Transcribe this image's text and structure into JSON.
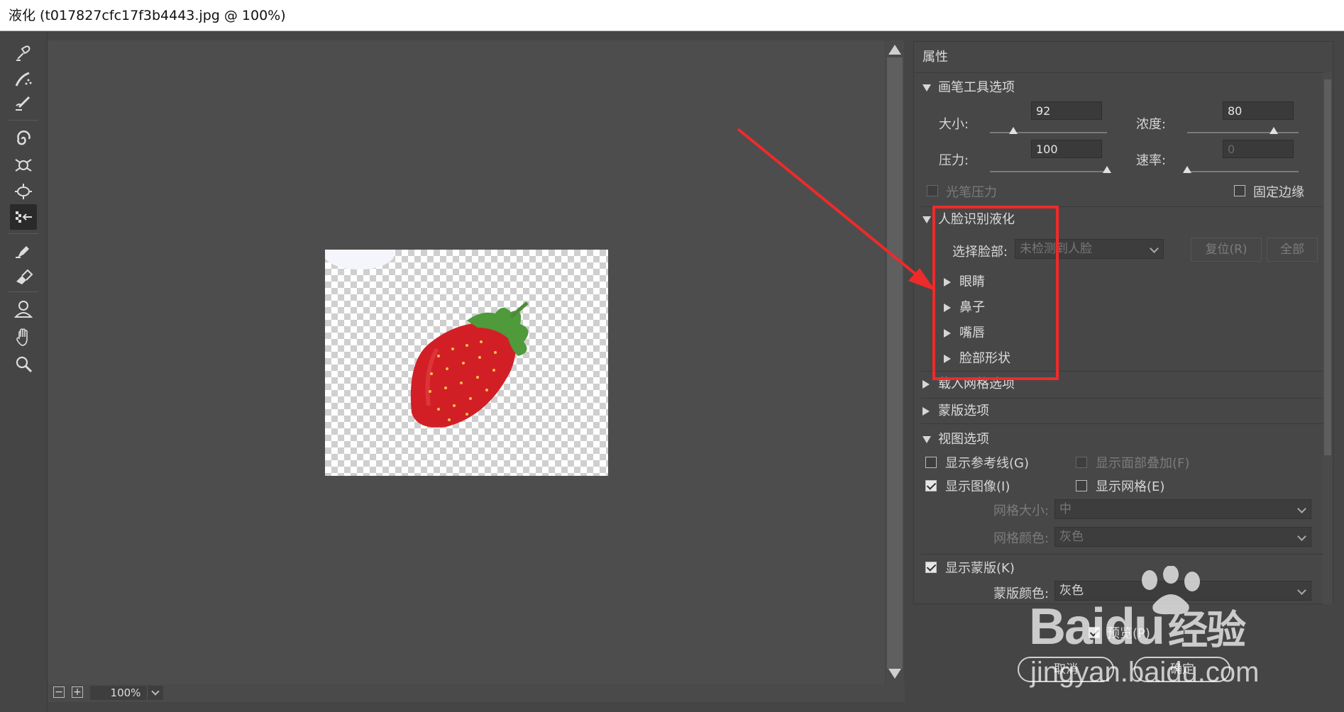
{
  "window": {
    "title": "液化 (t017827cfc17f3b4443.jpg @ 100%)"
  },
  "toolbar": {
    "tools": [
      {
        "name": "forward-warp-tool-icon"
      },
      {
        "name": "reconstruct-tool-icon"
      },
      {
        "name": "smooth-tool-icon"
      },
      {
        "name": "twirl-tool-icon"
      },
      {
        "name": "pucker-tool-icon"
      },
      {
        "name": "bloat-tool-icon"
      },
      {
        "name": "push-left-tool-icon"
      },
      {
        "name": "freeze-mask-tool-icon"
      },
      {
        "name": "thaw-mask-tool-icon"
      },
      {
        "name": "face-tool-icon"
      },
      {
        "name": "hand-tool-icon"
      },
      {
        "name": "zoom-tool-icon"
      }
    ]
  },
  "statusbar": {
    "zoom_out": "−",
    "zoom_in": "+",
    "zoom": "100%"
  },
  "properties": {
    "title": "属性",
    "brush": {
      "title": "画笔工具选项",
      "size_label": "大小:",
      "size_value": "92",
      "size_slider": 0.2,
      "density_label": "浓度:",
      "density_value": "80",
      "density_slider": 0.78,
      "pressure_label": "压力:",
      "pressure_value": "100",
      "pressure_slider": 1.0,
      "rate_label": "速率:",
      "rate_value": "0",
      "rate_slider": 0.0,
      "stylus_label": "光笔压力",
      "pin_edges_label": "固定边缘"
    },
    "face": {
      "title": "人脸识别液化",
      "select_label": "选择脸部:",
      "select_value": "未检测到人脸",
      "reset_label": "复位(R)",
      "all_label": "全部",
      "items": [
        "眼睛",
        "鼻子",
        "嘴唇",
        "脸部形状"
      ]
    },
    "load_mesh": {
      "title": "载入网格选项"
    },
    "mask": {
      "title": "蒙版选项"
    },
    "view": {
      "title": "视图选项",
      "show_guides": "显示参考线(G)",
      "show_face_overlay": "显示面部叠加(F)",
      "show_image": "显示图像(I)",
      "show_mesh": "显示网格(E)",
      "mesh_size_label": "网格大小:",
      "mesh_size_value": "中",
      "mesh_color_label": "网格颜色:",
      "mesh_color_value": "灰色",
      "show_mask": "显示蒙版(K)",
      "mask_color_label": "蒙版颜色:",
      "mask_color_value": "灰色"
    }
  },
  "footer": {
    "preview": "预览(P)",
    "cancel": "取消",
    "ok": "确定"
  },
  "watermark": {
    "brand": "Baidu",
    "brand_cn": "经验",
    "url": "jingyan.baidu.com"
  }
}
